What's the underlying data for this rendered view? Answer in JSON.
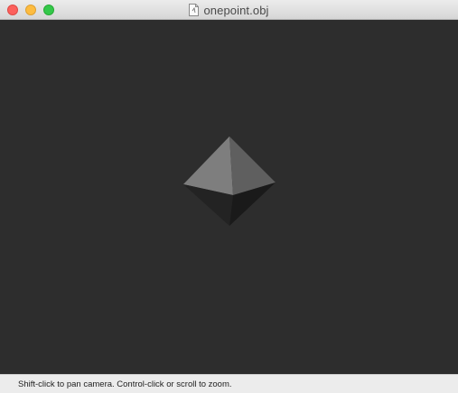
{
  "window": {
    "title": "onepoint.obj",
    "title_icon": "document-icon"
  },
  "traffic_lights": {
    "close": "#fc605c",
    "minimize": "#fdbc40",
    "zoom": "#34c84a"
  },
  "viewport": {
    "background": "#2d2d2d",
    "model": "octahedron",
    "face_colors": {
      "top_left": "#7e7e7e",
      "top_right": "#5f5f5f",
      "bottom_left": "#232323",
      "bottom_right": "#1a1a1a"
    }
  },
  "statusbar": {
    "hint": "Shift-click to pan camera. Control-click or scroll to zoom."
  }
}
